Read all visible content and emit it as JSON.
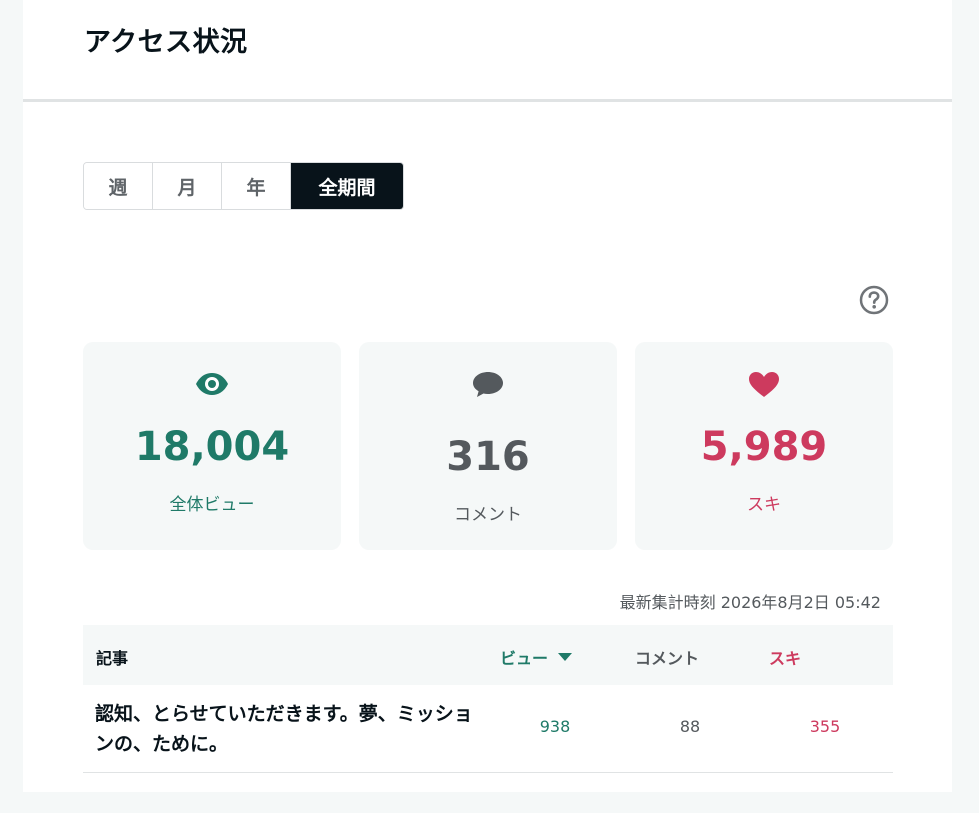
{
  "header": {
    "title": "アクセス状況"
  },
  "period_tabs": [
    {
      "label": "週",
      "active": false
    },
    {
      "label": "月",
      "active": false
    },
    {
      "label": "年",
      "active": false
    },
    {
      "label": "全期間",
      "active": true
    }
  ],
  "help": {
    "icon": "question-circle-icon"
  },
  "stats": {
    "views": {
      "icon": "eye-icon",
      "value": "18,004",
      "label": "全体ビュー",
      "color": "#1f7a68"
    },
    "comments": {
      "icon": "comment-bubble-icon",
      "value": "316",
      "label": "コメント",
      "color": "#54595d"
    },
    "likes": {
      "icon": "heart-icon",
      "value": "5,989",
      "label": "スキ",
      "color": "#cd3a5e"
    }
  },
  "updated": "最新集計時刻 2026年8月2日 05:42",
  "table": {
    "headers": {
      "article": "記事",
      "views": "ビュー",
      "comments": "コメント",
      "likes": "スキ"
    },
    "sort_indicator": "caret-down-icon",
    "rows": [
      {
        "title": "認知、とらせていただきます。夢、ミッションの、ために。",
        "views": "938",
        "comments": "88",
        "likes": "355"
      }
    ]
  }
}
